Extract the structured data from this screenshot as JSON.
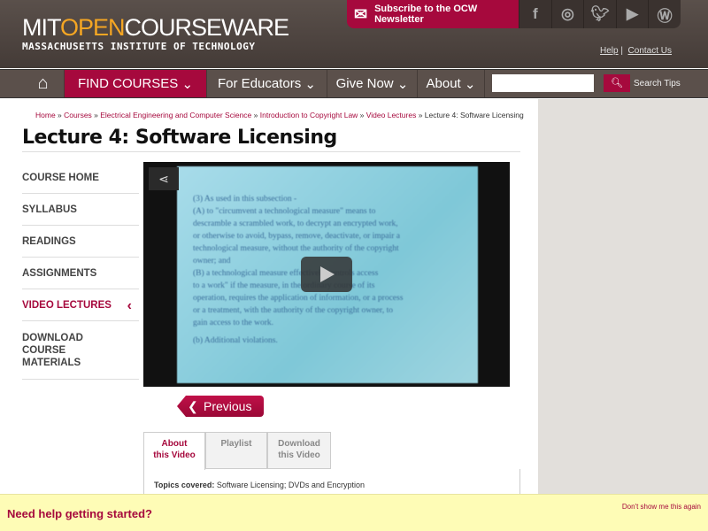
{
  "header": {
    "logo_mit": "MIT",
    "logo_open": "OPEN",
    "logo_courseware": "COURSEWARE",
    "tagline": "MASSACHUSETTS INSTITUTE OF TECHNOLOGY",
    "subscribe": "Subscribe to the OCW Newsletter",
    "social": [
      "facebook-icon",
      "instagram-icon",
      "twitter-icon",
      "youtube-icon",
      "wordpress-icon"
    ],
    "help": "Help",
    "contact": "Contact Us"
  },
  "nav": {
    "find_courses": "FIND COURSES",
    "educators": "For Educators",
    "give": "Give Now",
    "about": "About",
    "search_value": "",
    "search_tips": "Search Tips"
  },
  "breadcrumb": {
    "items": [
      "Home",
      "Courses",
      "Electrical Engineering and Computer Science",
      "Introduction to Copyright Law",
      "Video Lectures"
    ],
    "current": "Lecture 4: Software Licensing"
  },
  "page_title": "Lecture 4: Software Licensing",
  "menu": [
    "COURSE HOME",
    "SYLLABUS",
    "READINGS",
    "ASSIGNMENTS",
    "VIDEO LECTURES",
    "DOWNLOAD COURSE MATERIALS"
  ],
  "video": {
    "lines": [
      "(3) As used in this subsection -",
      "(A) to \"circumvent a technological measure\" means to",
      "descramble a scrambled work, to decrypt an encrypted work,",
      "or otherwise to avoid, bypass, remove, deactivate, or impair a",
      "technological measure, without the authority of the copyright",
      "owner; and",
      "(B) a technological measure effectively controls access",
      "to a work\" if the measure, in the ordinary course of its",
      "operation, requires the application of information, or a process",
      "or a treatment, with the authority of the copyright owner, to",
      "gain access to the work.",
      "(b) Additional violations."
    ]
  },
  "previous": "Previous",
  "tabs": [
    {
      "l1": "About",
      "l2": "this Video"
    },
    {
      "l1": "Playlist",
      "l2": ""
    },
    {
      "l1": "Download",
      "l2": "this Video"
    }
  ],
  "topics": {
    "label": "Topics covered:",
    "value": "Software Licensing; DVDs and Encryption"
  },
  "help": {
    "question": "Need help getting started?",
    "dismiss": "Don't show me this again"
  },
  "colors": {
    "brand": "#a6093d",
    "header": "#4a403c",
    "sidebar": "#e2dfdb",
    "banner": "#fefcb6"
  }
}
